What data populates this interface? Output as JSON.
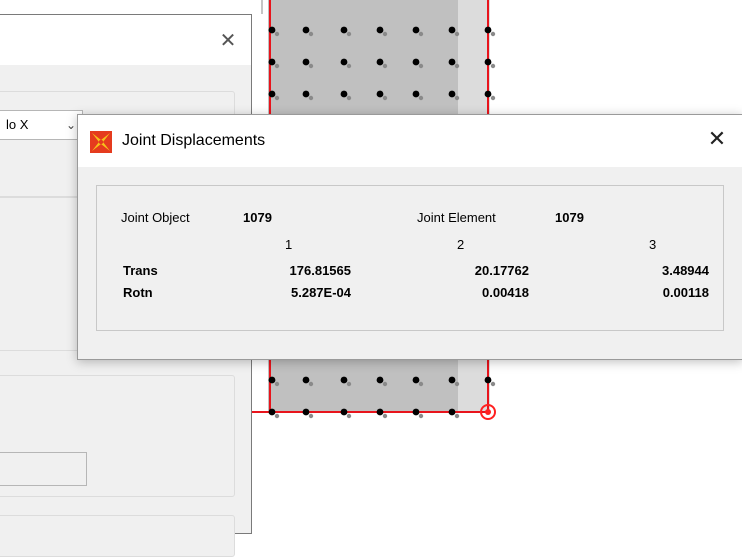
{
  "dialog": {
    "title": "Joint Displacements",
    "joint_object_label": "Joint  Object",
    "joint_object_value": "1079",
    "joint_element_label": "Joint Element",
    "joint_element_value": "1079",
    "columns": [
      "1",
      "2",
      "3"
    ],
    "rows": [
      {
        "label": "Trans",
        "values": [
          "176.81565",
          "20.17762",
          "3.48944"
        ]
      },
      {
        "label": "Rotn",
        "values": [
          "5.287E-04",
          "0.00418",
          "0.00118"
        ]
      }
    ],
    "close_glyph": "✕",
    "app_icon": "sap2000-logo-icon"
  },
  "background_window": {
    "combo_value": "lo X",
    "close_glyph": "✕"
  },
  "colors": {
    "model_fill": "#c0c0c0",
    "frame_line": "#e8141c",
    "node": "#000000",
    "selected_joint": "#ff2020"
  }
}
